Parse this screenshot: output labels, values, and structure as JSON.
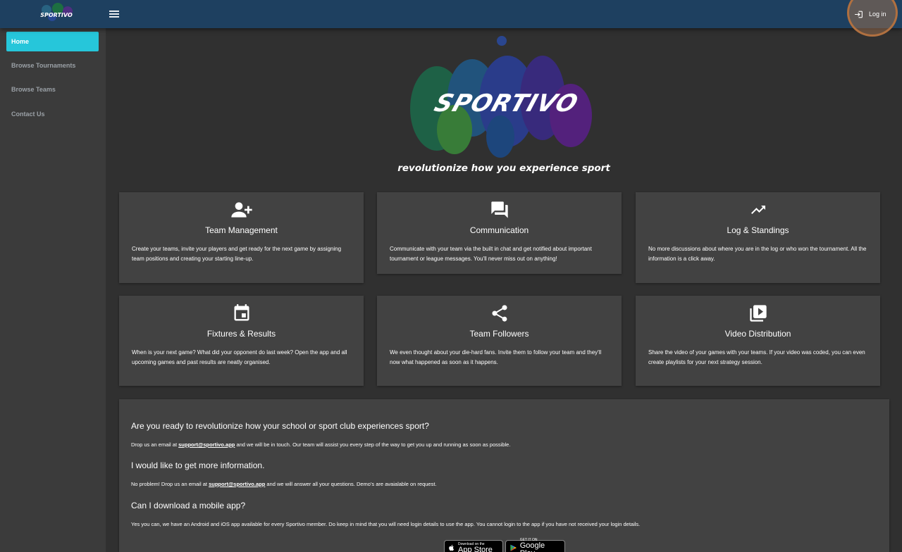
{
  "header": {
    "login_label": "Log in",
    "logo_text": "SPORTIVO"
  },
  "sidebar": {
    "items": [
      {
        "label": "Home",
        "active": true
      },
      {
        "label": "Browse Tournaments"
      },
      {
        "label": "Browse Teams"
      },
      {
        "label": "Contact Us"
      }
    ]
  },
  "hero": {
    "brand": "SPORTIVO",
    "tagline": "revolutionize how you experience sport"
  },
  "features": [
    {
      "icon": "person-add-icon",
      "title": "Team Management",
      "desc": "Create your teams, invite your players and get ready for the next game by assigning team positions and creating your starting line-up."
    },
    {
      "icon": "forum-icon",
      "title": "Communication",
      "desc": "Communicate with your team via the built in chat and get notified about important tournament or league messages. You'll never miss out on anything!"
    },
    {
      "icon": "trending-up-icon",
      "title": "Log & Standings",
      "desc": "No more discussions about where you are in the log or who won the tournament. All the information is a click away."
    },
    {
      "icon": "calendar-event-icon",
      "title": "Fixtures & Results",
      "desc": "When is your next game? What did your opponent do last week? Open the app and all upcoming games and past results are neatly organised."
    },
    {
      "icon": "share-icon",
      "title": "Team Followers",
      "desc": "We even thought about your die-hard fans. Invite them to follow your team and they'll now what happened as soon as it happens."
    },
    {
      "icon": "video-library-icon",
      "title": "Video Distribution",
      "desc": "Share the video of your games with your teams. If your video was coded, you can even create playlists for your next strategy session."
    }
  ],
  "info": {
    "q1": "Are you ready to revolutionize how your school or sport club experiences sport?",
    "a1_pre": "Drop us an email at ",
    "a1_link": "support@sportivo.app",
    "a1_post": " and we will be in touch. Our team will assist you every step of the way to get you up and running as soon as possible.",
    "q2": "I would like to get more information.",
    "a2_pre": "No problem! Drop us an email at ",
    "a2_link": "support@sportivo.app",
    "a2_post": " and we will answer all your questions. Demo's are avaialable on request.",
    "q3": "Can I download a mobile app?",
    "a3": "Yes you can, we have an Android and iOS app available for every Sportivo member. Do keep in mind that you will need login details to use the app. You cannot login to the app if you have not received your login details."
  },
  "stores": {
    "apple_small": "Download on the",
    "apple_big": "App Store",
    "google_small": "GET IT ON",
    "google_big": "Google Play"
  },
  "colors": {
    "topbar": "#1e4060",
    "accent": "#26c6da",
    "card": "#424242",
    "background": "#303030",
    "sidebar": "#3b3b3b"
  }
}
